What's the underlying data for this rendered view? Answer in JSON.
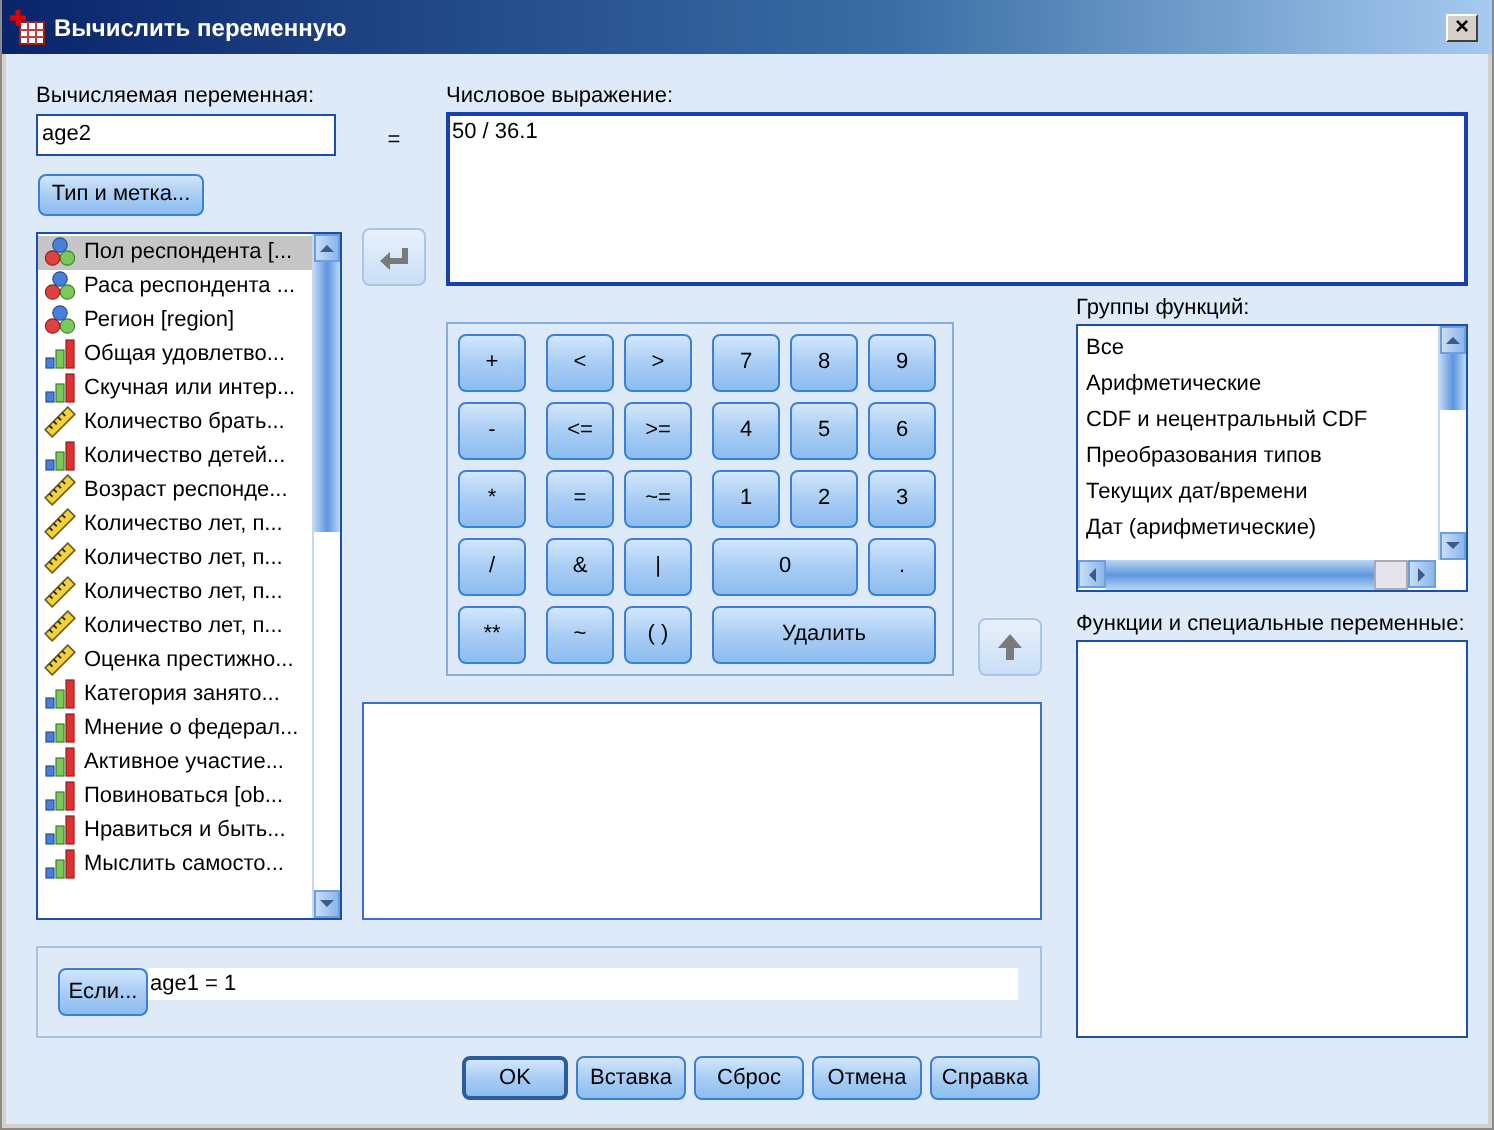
{
  "window": {
    "title": "Вычислить переменную",
    "close": "×"
  },
  "target": {
    "label": "Вычисляемая переменная:",
    "value": "age2"
  },
  "type_label_button": "Тип и метка...",
  "equals": "=",
  "variables": [
    {
      "label": "Пол респондента [...",
      "kind": "nominal",
      "selected": true
    },
    {
      "label": "Раса респондента ...",
      "kind": "nominal",
      "selected": false
    },
    {
      "label": "Регион [region]",
      "kind": "nominal",
      "selected": false
    },
    {
      "label": "Общая удовлетво...",
      "kind": "ordinal",
      "selected": false
    },
    {
      "label": "Скучная или интер...",
      "kind": "ordinal",
      "selected": false
    },
    {
      "label": "Количество брать...",
      "kind": "scale",
      "selected": false
    },
    {
      "label": "Количество детей...",
      "kind": "ordinal",
      "selected": false
    },
    {
      "label": "Возраст респонде...",
      "kind": "scale",
      "selected": false
    },
    {
      "label": "Количество лет, п...",
      "kind": "scale",
      "selected": false
    },
    {
      "label": "Количество лет, п...",
      "kind": "scale",
      "selected": false
    },
    {
      "label": "Количество лет, п...",
      "kind": "scale",
      "selected": false
    },
    {
      "label": "Количество лет, п...",
      "kind": "scale",
      "selected": false
    },
    {
      "label": "Оценка престижно...",
      "kind": "scale",
      "selected": false
    },
    {
      "label": "Категория занято...",
      "kind": "ordinal",
      "selected": false
    },
    {
      "label": "Мнение о федерал...",
      "kind": "ordinal",
      "selected": false
    },
    {
      "label": "Активное участие...",
      "kind": "ordinal",
      "selected": false
    },
    {
      "label": "Повиноваться [ob...",
      "kind": "ordinal",
      "selected": false
    },
    {
      "label": "Нравиться и быть...",
      "kind": "ordinal",
      "selected": false
    },
    {
      "label": "Мыслить самосто...",
      "kind": "ordinal",
      "selected": false
    }
  ],
  "expression": {
    "label": "Числовое выражение:",
    "value": "50 / 36.1"
  },
  "keypad": [
    {
      "label": "+",
      "kind": "key"
    },
    {
      "label": "<",
      "kind": "key"
    },
    {
      "label": ">",
      "kind": "key"
    },
    {
      "label": "7",
      "kind": "key"
    },
    {
      "label": "8",
      "kind": "key"
    },
    {
      "label": "9",
      "kind": "key"
    },
    {
      "label": "-",
      "kind": "key"
    },
    {
      "label": "<=",
      "kind": "key"
    },
    {
      "label": ">=",
      "kind": "key"
    },
    {
      "label": "4",
      "kind": "key"
    },
    {
      "label": "5",
      "kind": "key"
    },
    {
      "label": "6",
      "kind": "key"
    },
    {
      "label": "*",
      "kind": "key"
    },
    {
      "label": "=",
      "kind": "key"
    },
    {
      "label": "~=",
      "kind": "key"
    },
    {
      "label": "1",
      "kind": "key"
    },
    {
      "label": "2",
      "kind": "key"
    },
    {
      "label": "3",
      "kind": "key"
    },
    {
      "label": "/",
      "kind": "key"
    },
    {
      "label": "&",
      "kind": "key"
    },
    {
      "label": "|",
      "kind": "key"
    },
    {
      "label": "0",
      "kind": "wide"
    },
    {
      "label": ".",
      "kind": "key"
    },
    {
      "label": "**",
      "kind": "key"
    },
    {
      "label": "~",
      "kind": "key"
    },
    {
      "label": "( )",
      "kind": "key"
    },
    {
      "label": "Удалить",
      "kind": "wider"
    }
  ],
  "function_groups": {
    "label": "Группы функций:",
    "items": [
      {
        "label": "Все"
      },
      {
        "label": "Арифметические"
      },
      {
        "label": "CDF и нецентральный CDF"
      },
      {
        "label": "Преобразования типов"
      },
      {
        "label": "Текущих дат/времени"
      },
      {
        "label": "Дат (арифметические)"
      }
    ]
  },
  "functions": {
    "label": "Функции и специальные переменные:"
  },
  "condition": {
    "button": "Если...",
    "value": "age1 = 1"
  },
  "buttons": [
    {
      "label": "OK",
      "default": true
    },
    {
      "label": "Вставка",
      "default": false
    },
    {
      "label": "Сброс",
      "default": false
    },
    {
      "label": "Отмена",
      "default": false
    },
    {
      "label": "Справка",
      "default": false
    }
  ]
}
